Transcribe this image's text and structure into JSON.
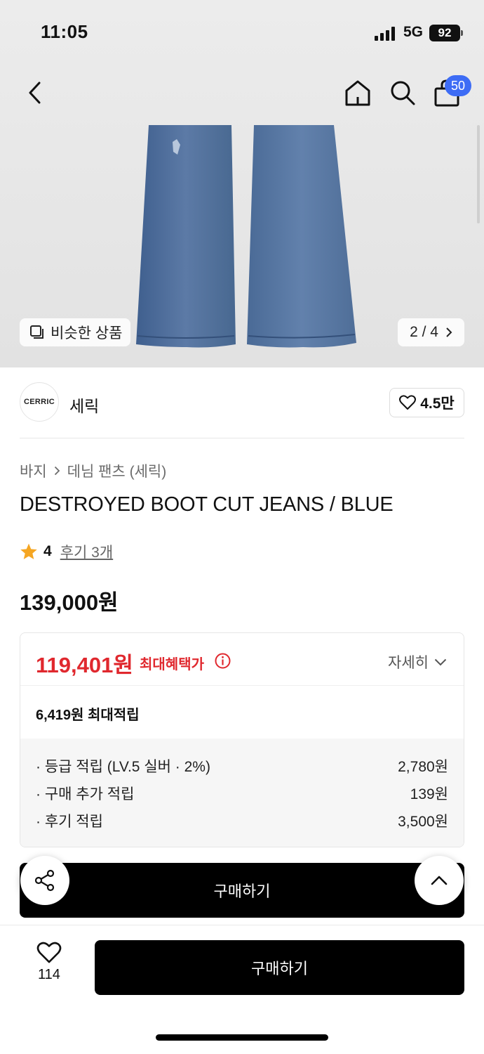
{
  "status_bar": {
    "time": "11:05",
    "network": "5G",
    "battery": "92"
  },
  "nav": {
    "cart_count": "50"
  },
  "image": {
    "similar_label": "비슷한 상품",
    "pager": "2 / 4"
  },
  "brand": {
    "logo_text": "CERRIC",
    "name": "세릭",
    "likes": "4.5만"
  },
  "breadcrumb": {
    "category": "바지",
    "subcategory": "데님 팬츠 (세릭)"
  },
  "product": {
    "title": "DESTROYED BOOT CUT JEANS / BLUE",
    "rating": "4",
    "reviews": "후기 3개",
    "price": "139,000원"
  },
  "benefit": {
    "max_price": "119,401원",
    "max_label": "최대혜택가",
    "detail_label": "자세히",
    "points_summary": "6,419원 최대적립",
    "points": [
      {
        "label": "· 등급 적립 (LV.5 실버 · 2%)",
        "value": "2,780원"
      },
      {
        "label": "· 구매 추가 적립",
        "value": "139원"
      },
      {
        "label": "· 후기 적립",
        "value": "3,500원"
      }
    ]
  },
  "actions": {
    "buy_inline": "구매하기",
    "buy_main": "구매하기",
    "wish_count": "114"
  },
  "colors": {
    "accent_red": "#e0282e",
    "badge_blue": "#3d6cf5",
    "star": "#f5a623"
  }
}
